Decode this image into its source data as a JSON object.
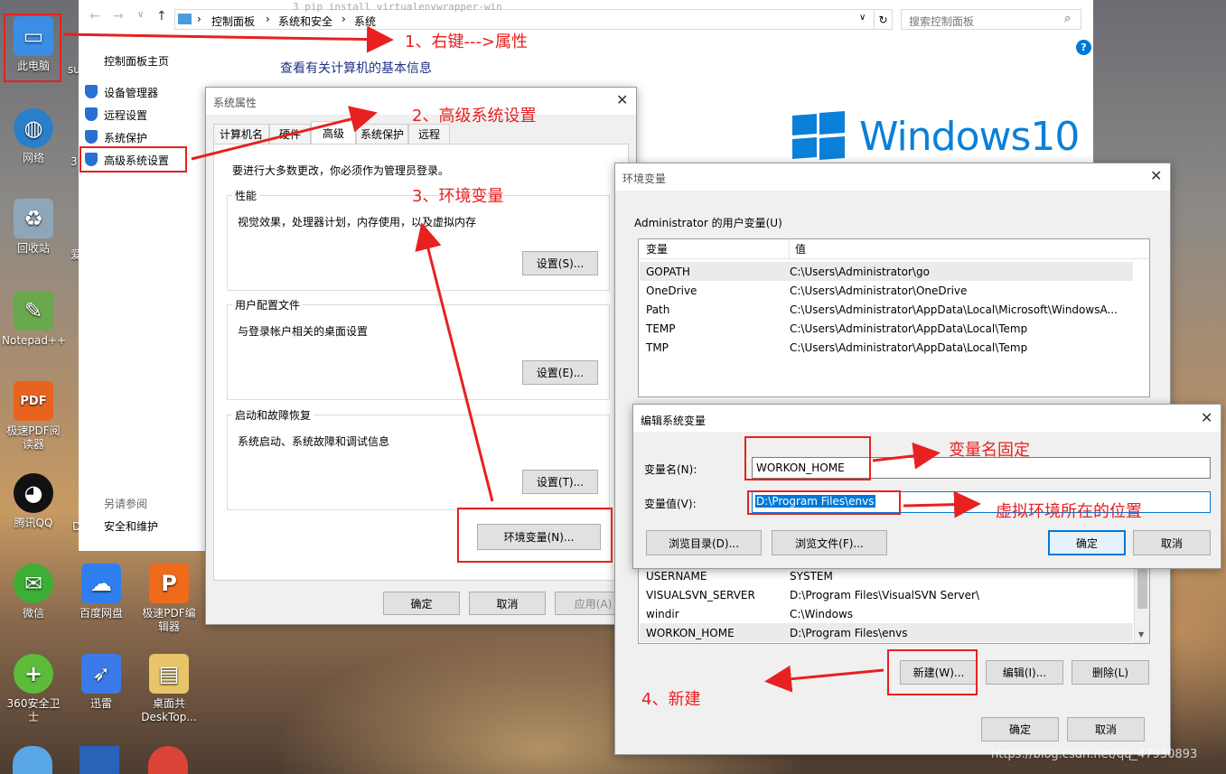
{
  "desktop": {
    "icons": [
      {
        "label": "此电脑",
        "color": "#3a8ee6",
        "glyph": "▭"
      },
      {
        "label": "网络",
        "color": "#2a7fc8",
        "glyph": "◍"
      },
      {
        "label": "回收站",
        "color": "#8fa6b8",
        "glyph": "♻"
      },
      {
        "label": "Notepad++",
        "color": "#6aa84f",
        "glyph": "✎"
      },
      {
        "label": "极速PDF阅读器",
        "color": "#e8641e",
        "glyph": "PDF"
      },
      {
        "label": "腾讯QQ",
        "color": "#111111",
        "glyph": "◕"
      },
      {
        "label": "微信",
        "color": "#3cb034",
        "glyph": "✉"
      },
      {
        "label": "百度网盘",
        "color": "#2f7ff0",
        "glyph": "☁"
      },
      {
        "label": "极速PDF编辑器",
        "color": "#f06a1c",
        "glyph": "P"
      },
      {
        "label": "360安全卫士",
        "color": "#5cbc3a",
        "glyph": "+"
      },
      {
        "label": "迅雷",
        "color": "#3b7ae8",
        "glyph": "➶"
      },
      {
        "label": "桌面共 DeskTop...",
        "color": "#e8c46a",
        "glyph": "▤"
      }
    ],
    "partial_labels": [
      "su",
      "3",
      "爱",
      "D"
    ]
  },
  "explorer": {
    "code_snippet": "3    pip install virtualenvwrapper-win",
    "breadcrumb": [
      "控制面板",
      "系统和安全",
      "系统"
    ],
    "search_placeholder": "搜索控制面板",
    "sidebar_home": "控制面板主页",
    "sidebar_links": [
      "设备管理器",
      "远程设置",
      "系统保护",
      "高级系统设置"
    ],
    "see_also_title": "另请参阅",
    "see_also_links": [
      "安全和维护"
    ],
    "main_heading": "查看有关计算机的基本信息",
    "windows_brand": "Windows",
    "windows_version": "10"
  },
  "sys_props": {
    "title": "系统属性",
    "tabs": [
      "计算机名",
      "硬件",
      "高级",
      "系统保护",
      "远程"
    ],
    "admin_note": "要进行大多数更改，你必须作为管理员登录。",
    "perf": {
      "title": "性能",
      "desc": "视觉效果，处理器计划，内存使用，以及虚拟内存",
      "button": "设置(S)..."
    },
    "profile": {
      "title": "用户配置文件",
      "desc": "与登录帐户相关的桌面设置",
      "button": "设置(E)..."
    },
    "startup": {
      "title": "启动和故障恢复",
      "desc": "系统启动、系统故障和调试信息",
      "button": "设置(T)..."
    },
    "env_button": "环境变量(N)...",
    "ok": "确定",
    "cancel": "取消",
    "apply": "应用(A)"
  },
  "env_vars": {
    "title": "环境变量",
    "user_section": "Administrator 的用户变量(U)",
    "col_var": "变量",
    "col_val": "值",
    "user_rows": [
      {
        "name": "GOPATH",
        "value": "C:\\Users\\Administrator\\go"
      },
      {
        "name": "OneDrive",
        "value": "C:\\Users\\Administrator\\OneDrive"
      },
      {
        "name": "Path",
        "value": "C:\\Users\\Administrator\\AppData\\Local\\Microsoft\\WindowsA..."
      },
      {
        "name": "TEMP",
        "value": "C:\\Users\\Administrator\\AppData\\Local\\Temp"
      },
      {
        "name": "TMP",
        "value": "C:\\Users\\Administrator\\AppData\\Local\\Temp"
      }
    ],
    "sys_rows": [
      {
        "name": "USERNAME",
        "value": "SYSTEM"
      },
      {
        "name": "VISUALSVN_SERVER",
        "value": "D:\\Program Files\\VisualSVN Server\\"
      },
      {
        "name": "windir",
        "value": "C:\\Windows"
      },
      {
        "name": "WORKON_HOME",
        "value": "D:\\Program Files\\envs"
      }
    ],
    "new_button": "新建(W)...",
    "edit_button": "编辑(I)...",
    "delete_button": "删除(L)",
    "ok": "确定",
    "cancel": "取消"
  },
  "edit_var": {
    "title": "编辑系统变量",
    "name_label": "变量名(N):",
    "name_value": "WORKON_HOME",
    "value_label": "变量值(V):",
    "value_value": "D:\\Program Files\\envs",
    "browse_dir": "浏览目录(D)...",
    "browse_file": "浏览文件(F)...",
    "ok": "确定",
    "cancel": "取消"
  },
  "annotations": {
    "step1": "1、右键--->属性",
    "step2": "2、高级系统设置",
    "step3": "3、环境变量",
    "step4": "4、新建",
    "var_name_fixed": "变量名固定",
    "venv_location": "虚拟环境所在的位置",
    "color": "#e82020"
  },
  "watermark": "https://blog.csdn.net/qq_47930893"
}
